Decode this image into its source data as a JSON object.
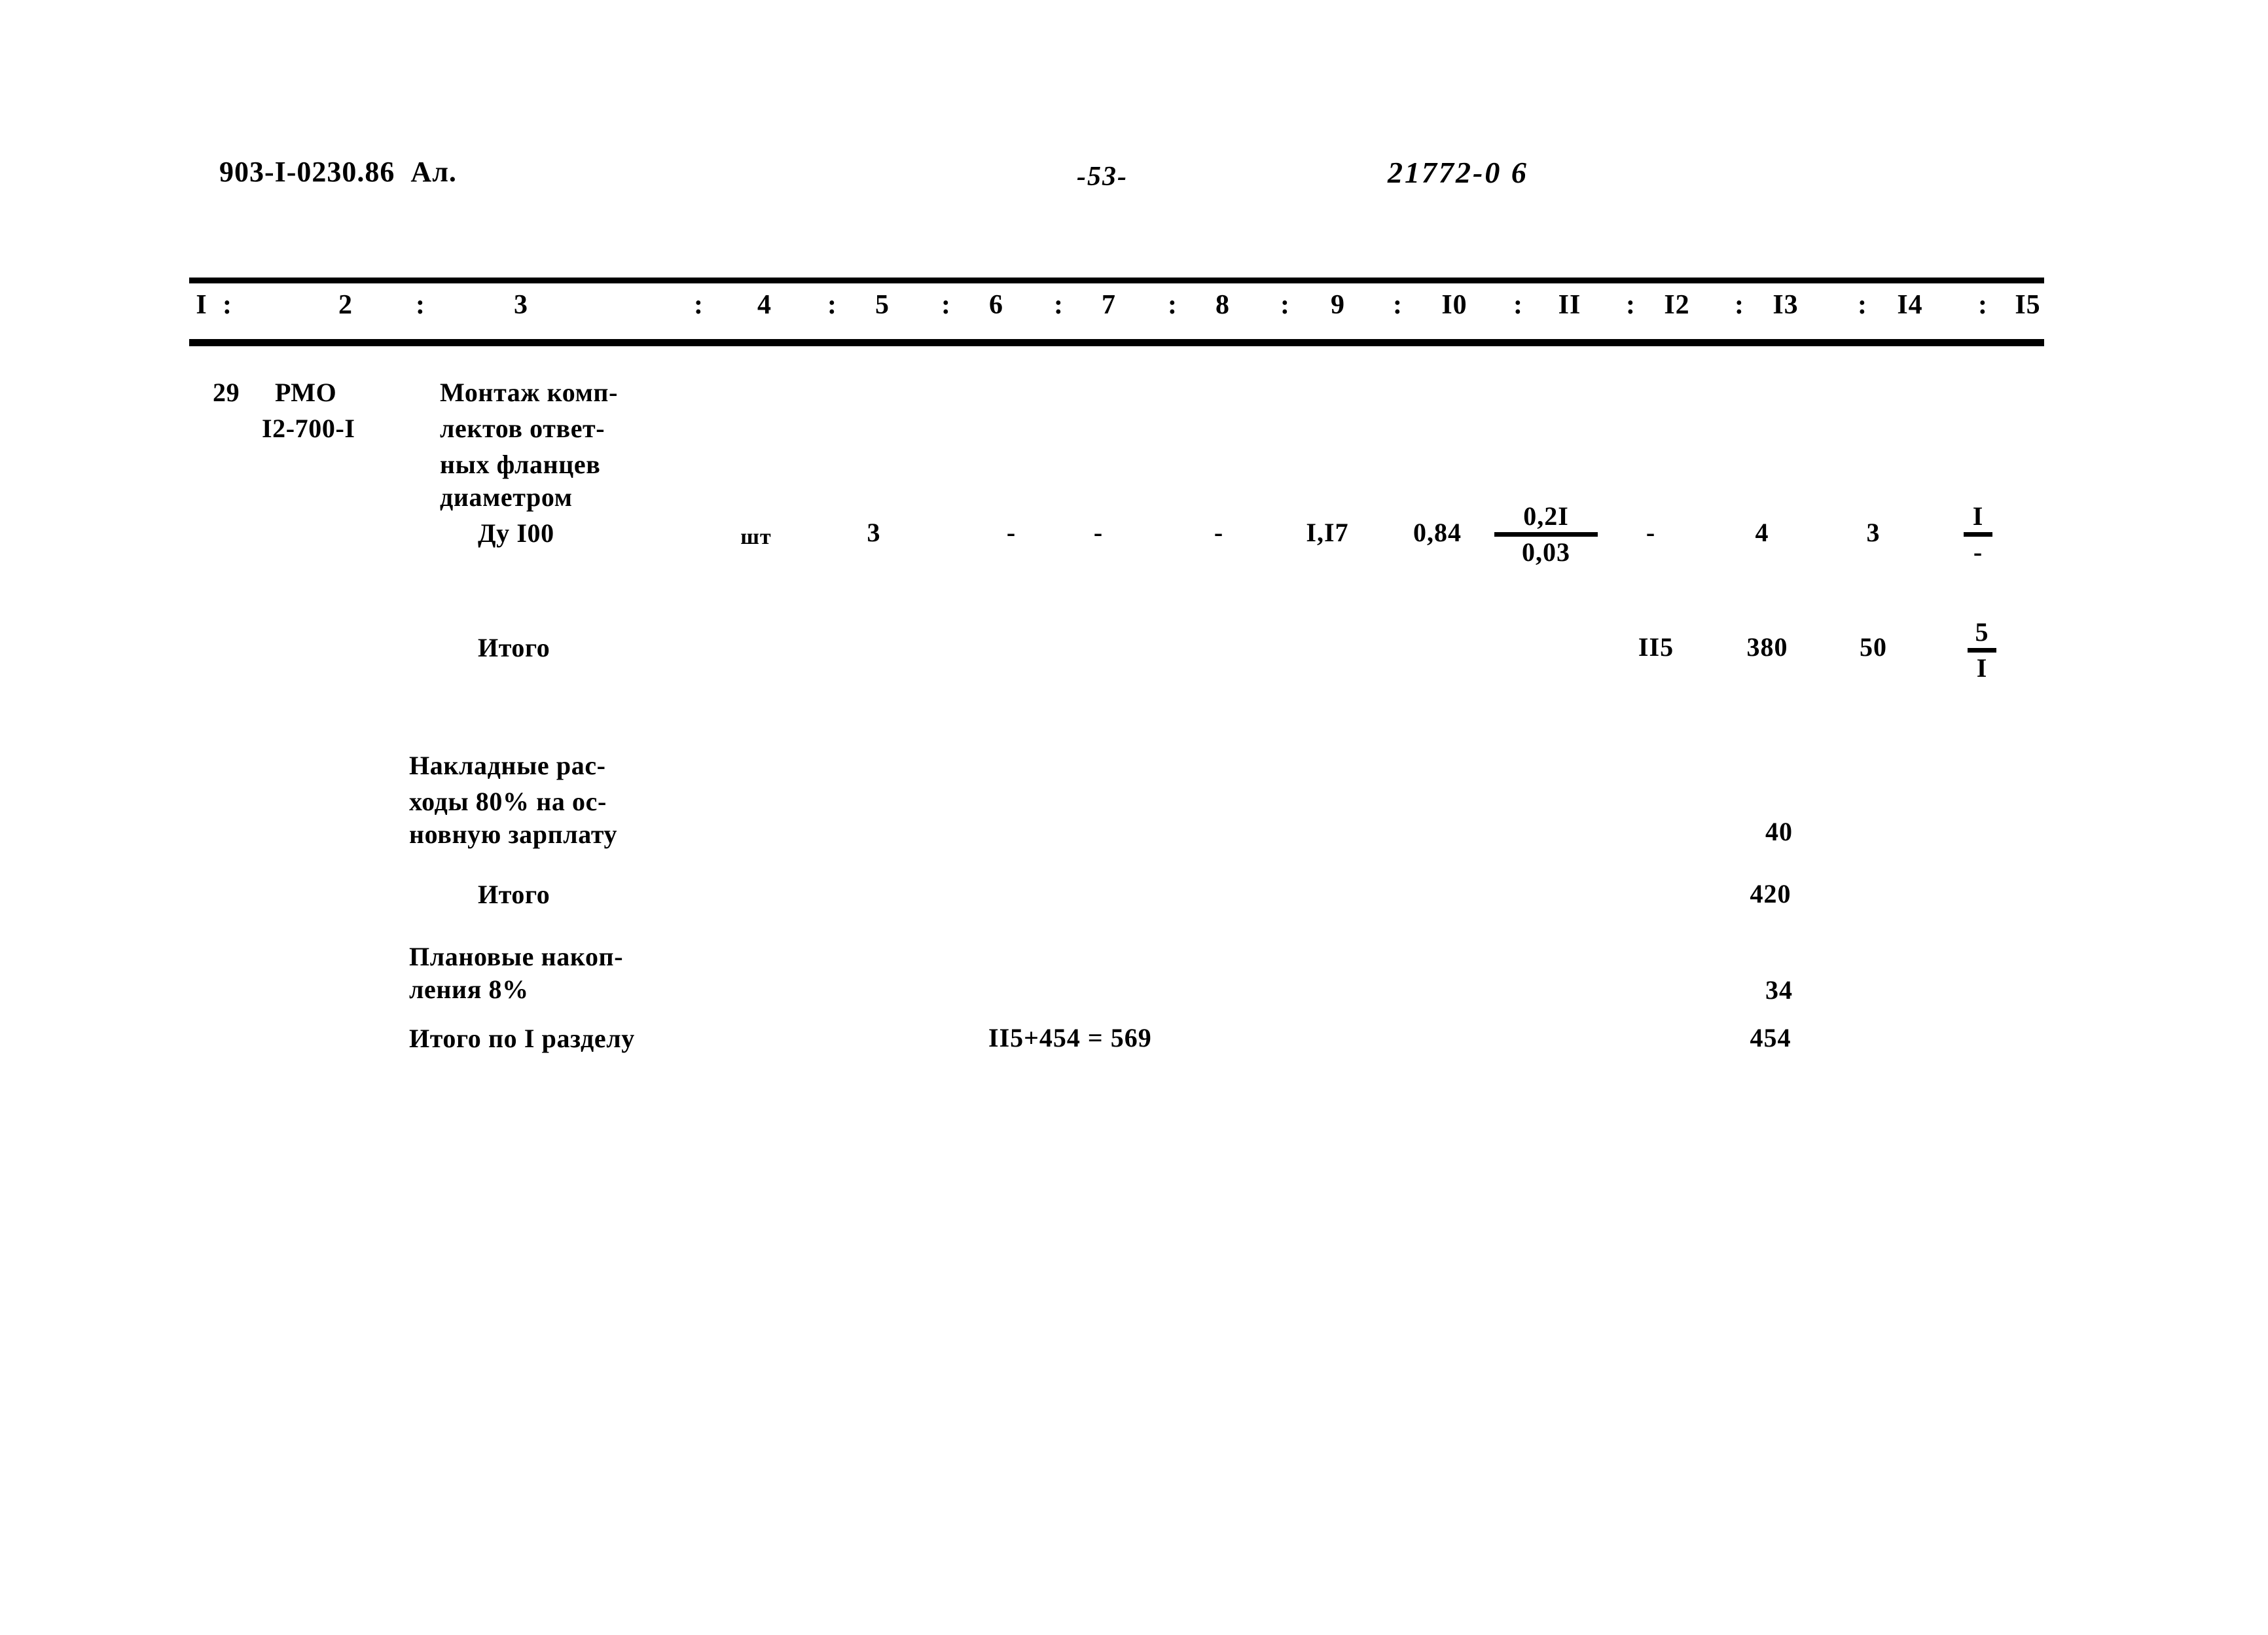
{
  "header": {
    "doc_code": "903-I-0230.86  Ал.",
    "page_number": "-53-",
    "archive_number": "21772-0 6"
  },
  "table": {
    "column_headers": [
      "I",
      "2",
      "3",
      "4",
      "5",
      "6",
      "7",
      "8",
      "9",
      "I0",
      "II",
      "I2",
      "I3",
      "I4",
      "I5"
    ],
    "column_separator": ":",
    "rows": [
      {
        "name": "row-position-29",
        "col1": "29",
        "col2_line1": "РМО",
        "col2_line2": "I2-700-I",
        "col3_line1": "Монтаж комп-",
        "col3_line2": "лектов ответ-",
        "col3_line3": "ных фланцев",
        "col3_line4": "диаметром",
        "col3_line5": "Ду I00",
        "col4": "шт",
        "col5": "3",
        "col6": "-",
        "col7": "-",
        "col8": "-",
        "col9": "I,I7",
        "col10": "0,84",
        "col11_numer": "0,2I",
        "col11_denom": "0,03",
        "col12": "-",
        "col13": "4",
        "col14": "3",
        "col15_numer": "I",
        "col15_denom": "-"
      },
      {
        "name": "row-total-1",
        "col3": "Итого",
        "col12": "II5",
        "col13": "380",
        "col14": "50",
        "col15_numer": "5",
        "col15_denom": "I"
      },
      {
        "name": "row-overhead",
        "col3_line1": "Накладные рас-",
        "col3_line2": "ходы 80% на ос-",
        "col3_line3": "новную зарплату",
        "col13": "40"
      },
      {
        "name": "row-total-2",
        "col3": "Итого",
        "col13": "420"
      },
      {
        "name": "row-planned-savings",
        "col3_line1": "Плановые накоп-",
        "col3_line2": "ления 8%",
        "col13": "34"
      },
      {
        "name": "row-section-total",
        "col3": "Итого по I разделу",
        "formula": "II5+454 = 569",
        "col13": "454"
      }
    ]
  }
}
